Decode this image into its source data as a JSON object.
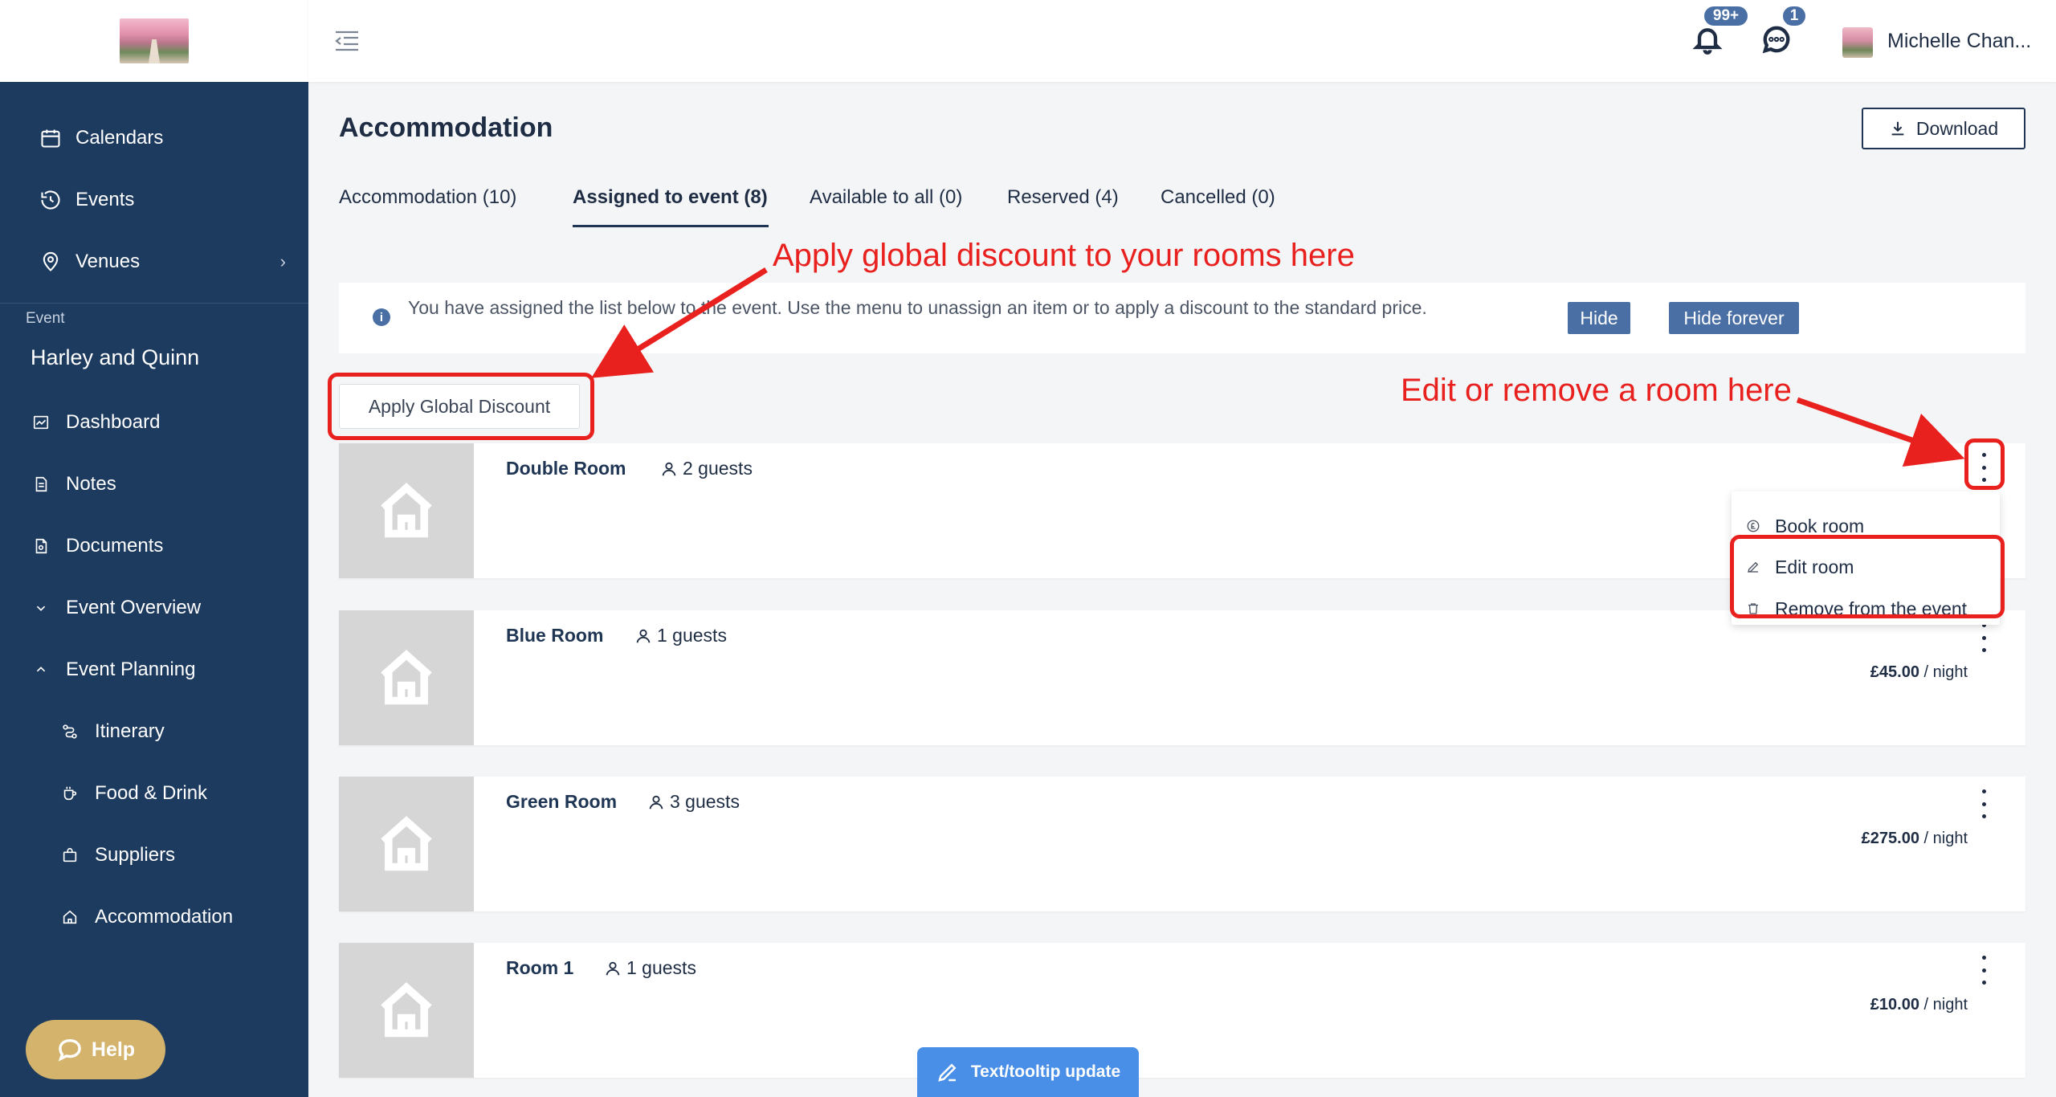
{
  "sidebar": {
    "items": [
      {
        "label": "Calendars",
        "icon": "calendar-icon"
      },
      {
        "label": "Events",
        "icon": "history-icon"
      },
      {
        "label": "Venues",
        "icon": "location-pin-icon"
      }
    ],
    "event_section_label": "Event",
    "event_name": "Harley and Quinn",
    "event_items": [
      {
        "label": "Dashboard",
        "icon": "chart-icon"
      },
      {
        "label": "Notes",
        "icon": "note-icon"
      },
      {
        "label": "Documents",
        "icon": "document-icon"
      },
      {
        "label": "Event Overview",
        "icon": "chevron-down-icon"
      },
      {
        "label": "Event Planning",
        "icon": "chevron-up-icon"
      }
    ],
    "planning_items": [
      {
        "label": "Itinerary",
        "icon": "route-icon"
      },
      {
        "label": "Food & Drink",
        "icon": "cup-icon"
      },
      {
        "label": "Suppliers",
        "icon": "bag-icon"
      },
      {
        "label": "Accommodation",
        "icon": "home-icon"
      }
    ],
    "help_label": "Help"
  },
  "header": {
    "notifications_badge": "99+",
    "messages_badge": "1",
    "user_name": "Michelle Chan..."
  },
  "page": {
    "title": "Accommodation",
    "download_label": "Download",
    "tabs": [
      {
        "label": "Accommodation (10)",
        "active": false
      },
      {
        "label": "Assigned to event (8)",
        "active": true
      },
      {
        "label": "Available to all (0)",
        "active": false
      },
      {
        "label": "Reserved (4)",
        "active": false
      },
      {
        "label": "Cancelled (0)",
        "active": false
      }
    ],
    "info_text": "You have assigned the list below to the event. Use the menu to unassign an item or to apply a discount to the standard price.",
    "hide_label": "Hide",
    "hide_forever_label": "Hide forever",
    "global_discount_label": "Apply Global Discount"
  },
  "rooms": [
    {
      "name": "Double Room",
      "guests": "2 guests",
      "price": "",
      "unit": ""
    },
    {
      "name": "Blue Room",
      "guests": "1 guests",
      "price": "£45.00",
      "unit": "/ night"
    },
    {
      "name": "Green Room",
      "guests": "3 guests",
      "price": "£275.00",
      "unit": "/ night"
    },
    {
      "name": "Room 1",
      "guests": "1 guests",
      "price": "£10.00",
      "unit": "/ night"
    }
  ],
  "dropdown": {
    "items": [
      {
        "label": "Book room",
        "icon": "pound-coin-icon"
      },
      {
        "label": "Edit room",
        "icon": "pencil-icon"
      },
      {
        "label": "Remove from the event",
        "icon": "trash-icon"
      }
    ]
  },
  "annotations": {
    "discount_hint": "Apply global discount to your rooms here",
    "edit_hint": "Edit or remove a room here",
    "color": "#e8211e"
  },
  "floating": {
    "tooltip_update_label": "Text/tooltip update"
  },
  "colors": {
    "sidebar": "#1d3a5f",
    "accent": "#4a6fa5",
    "help": "#d4b36d",
    "floating": "#4a8fe7"
  }
}
